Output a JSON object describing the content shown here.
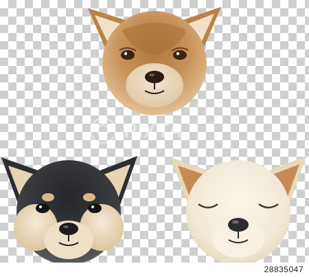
{
  "watermark": {
    "text": "PIXTA",
    "color": "#ffffff"
  },
  "image_id": "28835047",
  "icons": {
    "dog_top": "red-shiba-inu-face-icon",
    "dog_bottom_left": "black-and-tan-shiba-inu-face-icon",
    "dog_bottom_right": "cream-shiba-inu-face-icon"
  },
  "colors": {
    "checker_light": "#ffffff",
    "checker_dark": "#cfcfcf",
    "red_fur": "#c8925a",
    "black_fur": "#3a3c40",
    "cream_fur": "#f1e8d6",
    "tan_muzzle": "#e2ceac"
  }
}
